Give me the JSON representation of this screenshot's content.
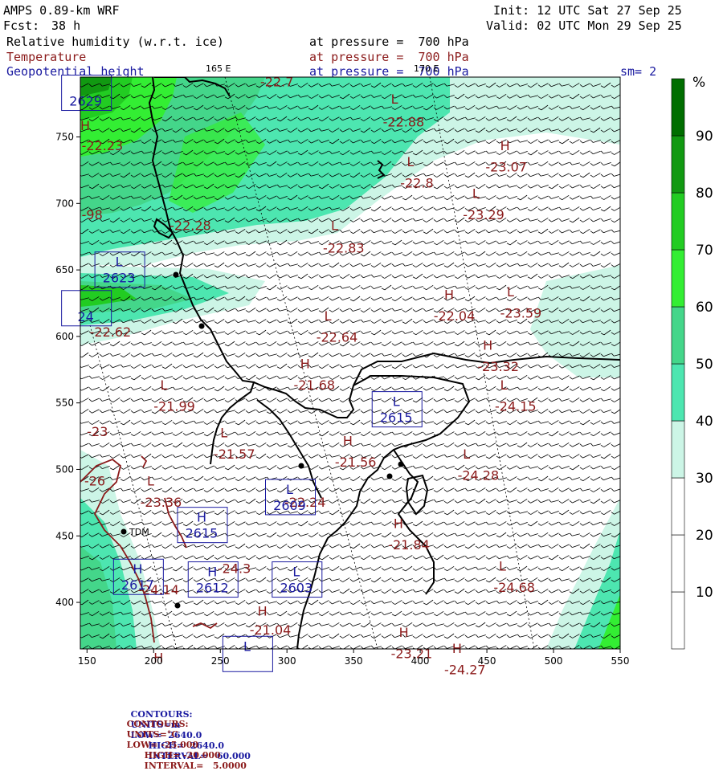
{
  "header": {
    "model": "AMPS 0.89-km WRF",
    "fcst_label": "Fcst:",
    "fcst_value": "38 h",
    "init": "Init: 12 UTC Sat 27 Sep 25",
    "valid": "Valid: 02 UTC Mon 29 Sep 25",
    "sm": "sm= 2",
    "fields": [
      {
        "name": "Relative humidity (w.r.t. ice)",
        "level": "at pressure =  700 hPa",
        "color": "#000000"
      },
      {
        "name": "Temperature",
        "level": "at pressure =  700 hPa",
        "color": "#8b1a1a"
      },
      {
        "name": "Geopotential height",
        "level": "at pressure =  700 hPa",
        "color": "#1a1aa0"
      }
    ]
  },
  "map": {
    "lon_labels": [
      "165 E",
      "170 E"
    ],
    "x_ticks": [
      "150",
      "200",
      "250",
      "300",
      "350",
      "400",
      "450",
      "500",
      "550"
    ],
    "y_ticks": [
      "400",
      "450",
      "500",
      "550",
      "600",
      "650",
      "700",
      "750"
    ],
    "xlim": [
      145,
      550
    ],
    "ylim": [
      365,
      795
    ],
    "station_label": "TDM",
    "temperature_labels": [
      {
        "text": "-22.7",
        "x": 280,
        "y": 788
      },
      {
        "text": "L",
        "x": 378,
        "y": 775
      },
      {
        "text": "-22.88",
        "x": 372,
        "y": 758
      },
      {
        "text": "H",
        "x": 145,
        "y": 755
      },
      {
        "text": "-22.23",
        "x": 146,
        "y": 740
      },
      {
        "text": "H",
        "x": 460,
        "y": 740
      },
      {
        "text": "-23.07",
        "x": 449,
        "y": 724
      },
      {
        "text": "L",
        "x": 390,
        "y": 728
      },
      {
        "text": "-22.8",
        "x": 385,
        "y": 712
      },
      {
        "text": "L",
        "x": 439,
        "y": 704
      },
      {
        "text": "-23.29",
        "x": 432,
        "y": 688
      },
      {
        "text": "-98",
        "x": 146,
        "y": 688
      },
      {
        "text": "-22.28",
        "x": 212,
        "y": 680
      },
      {
        "text": "L",
        "x": 333,
        "y": 680
      },
      {
        "text": "-22.83",
        "x": 327,
        "y": 663
      },
      {
        "text": "H",
        "x": 418,
        "y": 628
      },
      {
        "text": "-22.04",
        "x": 410,
        "y": 612
      },
      {
        "text": "L",
        "x": 465,
        "y": 630
      },
      {
        "text": "-23.59",
        "x": 460,
        "y": 614
      },
      {
        "text": "L",
        "x": 328,
        "y": 612
      },
      {
        "text": "-22.64",
        "x": 322,
        "y": 596
      },
      {
        "text": "-22.62",
        "x": 152,
        "y": 600
      },
      {
        "text": "H",
        "x": 447,
        "y": 590
      },
      {
        "text": "-23.32",
        "x": 443,
        "y": 574
      },
      {
        "text": "H",
        "x": 310,
        "y": 576
      },
      {
        "text": "-21.68",
        "x": 305,
        "y": 560
      },
      {
        "text": "L",
        "x": 205,
        "y": 560
      },
      {
        "text": "-21.99",
        "x": 200,
        "y": 544
      },
      {
        "text": "L",
        "x": 460,
        "y": 560
      },
      {
        "text": "-24.15",
        "x": 456,
        "y": 544
      },
      {
        "text": "-23",
        "x": 150,
        "y": 525
      },
      {
        "text": "L",
        "x": 250,
        "y": 524
      },
      {
        "text": "-21.57",
        "x": 245,
        "y": 508
      },
      {
        "text": "H",
        "x": 342,
        "y": 518
      },
      {
        "text": "-21.56",
        "x": 336,
        "y": 502
      },
      {
        "text": "L",
        "x": 432,
        "y": 508
      },
      {
        "text": "-24.28",
        "x": 428,
        "y": 492
      },
      {
        "text": "-26",
        "x": 148,
        "y": 488
      },
      {
        "text": "L",
        "x": 195,
        "y": 488
      },
      {
        "text": "-23.36",
        "x": 190,
        "y": 472
      },
      {
        "text": "-22.24",
        "x": 298,
        "y": 472
      },
      {
        "text": "H",
        "x": 380,
        "y": 456
      },
      {
        "text": "-21.84",
        "x": 376,
        "y": 440
      },
      {
        "text": "-24.3",
        "x": 248,
        "y": 422
      },
      {
        "text": "-24.14",
        "x": 188,
        "y": 406
      },
      {
        "text": "L",
        "x": 459,
        "y": 424
      },
      {
        "text": "-24.68",
        "x": 455,
        "y": 408
      },
      {
        "text": "H",
        "x": 278,
        "y": 390
      },
      {
        "text": "-21.04",
        "x": 272,
        "y": 376
      },
      {
        "text": "H",
        "x": 384,
        "y": 374
      },
      {
        "text": "-23.21",
        "x": 378,
        "y": 358
      },
      {
        "text": "H",
        "x": 424,
        "y": 362
      },
      {
        "text": "-24.27",
        "x": 418,
        "y": 346
      },
      {
        "text": "H",
        "x": 200,
        "y": 355
      }
    ],
    "height_boxes": [
      {
        "hl": "L",
        "value": "2623",
        "x": 174,
        "y": 649
      },
      {
        "hl": "L",
        "value": "2615",
        "x": 382,
        "y": 544
      },
      {
        "hl": "L",
        "value": "2609",
        "x": 302,
        "y": 478
      },
      {
        "hl": "H",
        "value": "2615",
        "x": 236,
        "y": 457
      },
      {
        "hl": "H",
        "value": "2617",
        "x": 188,
        "y": 418
      },
      {
        "hl": "H",
        "value": "2612",
        "x": 244,
        "y": 416
      },
      {
        "hl": "L",
        "value": "2603",
        "x": 307,
        "y": 416
      },
      {
        "hl": "",
        "value": "2629",
        "x": 149,
        "y": 782
      },
      {
        "hl": "",
        "value": "24",
        "x": 149,
        "y": 620
      },
      {
        "hl": "L",
        "value": "",
        "x": 270,
        "y": 360
      }
    ]
  },
  "colorbar": {
    "unit": "%",
    "labels": [
      "90",
      "80",
      "70",
      "60",
      "50",
      "40",
      "30",
      "20",
      "10"
    ],
    "colors": [
      "#ffffff",
      "#ffffff",
      "#ffffff",
      "#ccf5e6",
      "#4de6b0",
      "#44d68a",
      "#33ee33",
      "#22cc22",
      "#119911",
      "#006e00"
    ]
  },
  "footer": {
    "line1": {
      "label": "CONTOURS:",
      "units": "UNITS=m",
      "low": "LOW=  2640.0",
      "high": "HIGH=  2640.0",
      "interval": "INTERVAL=   60.000",
      "color": "#1a1aa0"
    },
    "line2": {
      "label": "CONTOURS:",
      "units": "UNITS=°C",
      "low": "LOW= -25.000",
      "high": "HIGH= -20.000",
      "interval": "INTERVAL=   5.0000",
      "color": "#8b1a1a"
    }
  }
}
